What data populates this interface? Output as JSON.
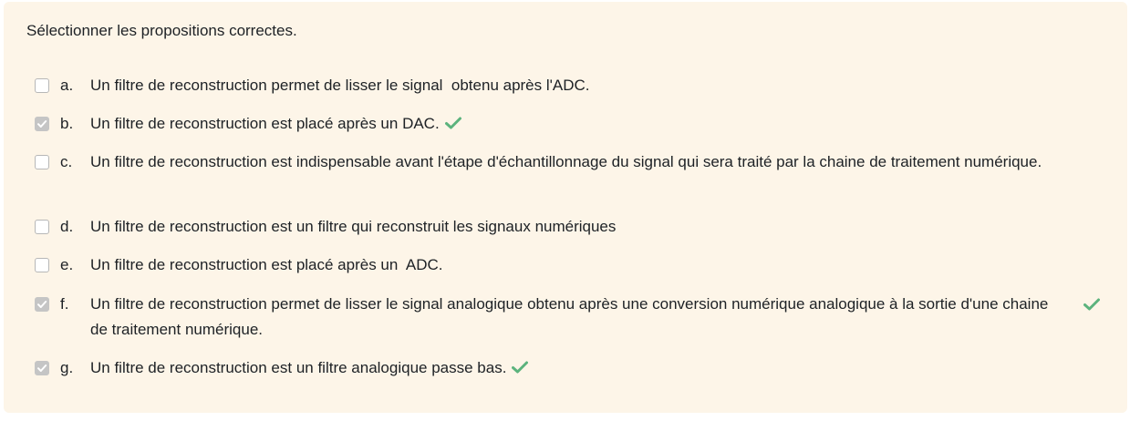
{
  "question": {
    "prompt": "Sélectionner les propositions correctes."
  },
  "answers": [
    {
      "letter": "a.",
      "text": "Un filtre de reconstruction permet de lisser le signal  obtenu après l'ADC.",
      "checked": false,
      "correct_mark": false
    },
    {
      "letter": "b.",
      "text": "Un filtre de reconstruction est placé après un  DAC.",
      "checked": true,
      "correct_mark": true
    },
    {
      "letter": "c.",
      "text": "Un filtre de reconstruction est indispensable avant l'étape d'échantillonnage du signal qui sera traité par la chaine de traitement numérique.",
      "checked": false,
      "correct_mark": false
    },
    {
      "letter": "d.",
      "text": "Un filtre de reconstruction est un filtre qui reconstruit les signaux numériques",
      "checked": false,
      "correct_mark": false
    },
    {
      "letter": "e.",
      "text": "Un filtre de reconstruction est placé après un  ADC.",
      "checked": false,
      "correct_mark": false
    },
    {
      "letter": "f.",
      "text": "Un filtre de reconstruction permet de lisser le signal analogique obtenu après une conversion numérique analogique à la sortie d'une chaine de traitement numérique.",
      "checked": true,
      "correct_mark": true
    },
    {
      "letter": "g.",
      "text": "Un filtre de reconstruction est un filtre  analogique passe bas.",
      "checked": true,
      "correct_mark": true
    }
  ],
  "colors": {
    "panel_background": "#fdf5e8",
    "correct_tick": "#5cb37d",
    "checkbox_checked": "#c5c5c5"
  },
  "icons": {
    "checkbox": "checkbox-icon",
    "correct": "check-mark-icon"
  }
}
